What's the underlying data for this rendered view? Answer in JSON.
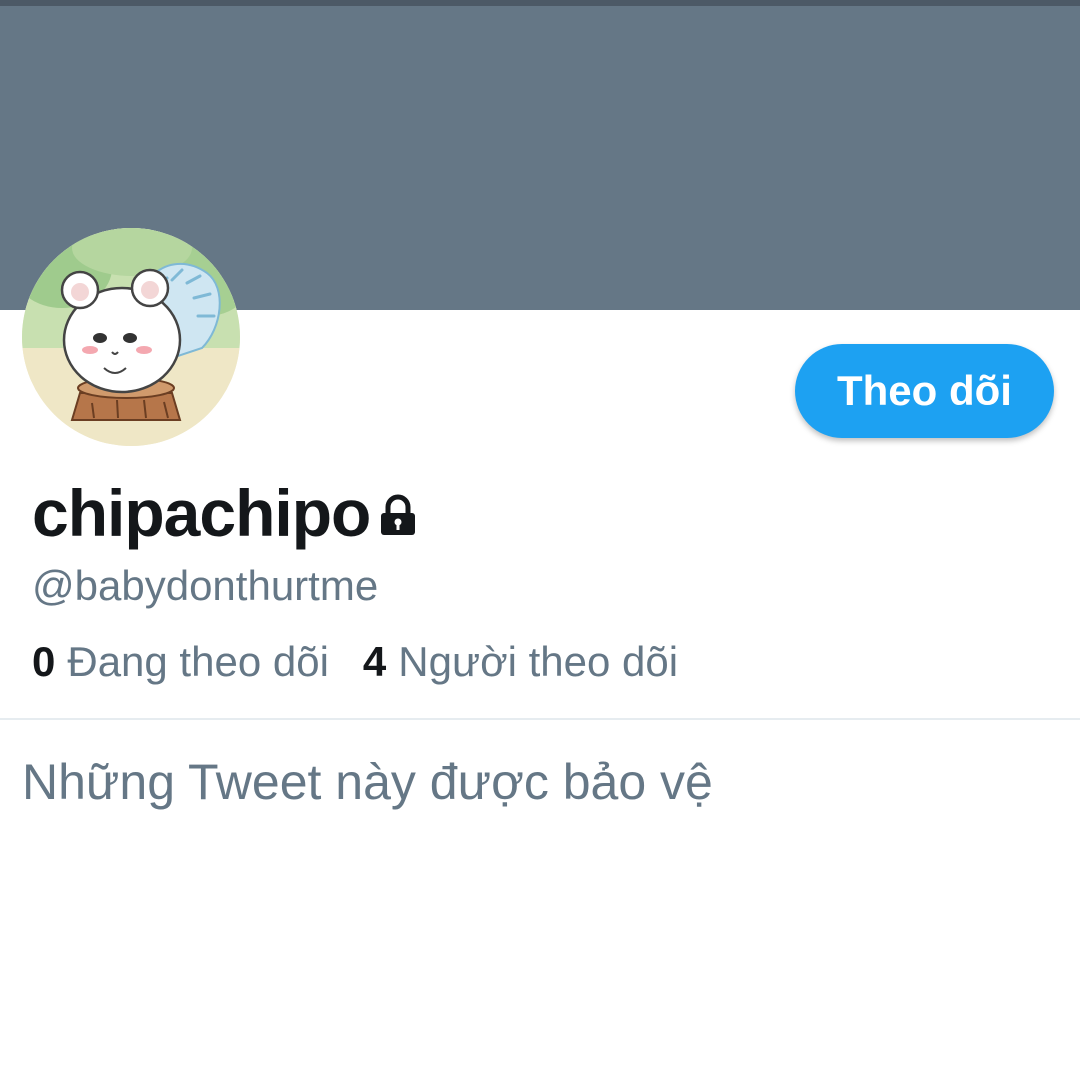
{
  "profile": {
    "display_name": "chipachipo",
    "handle": "@babydonthurtme",
    "protected": true,
    "avatar_icon": "chinchilla-on-stump-avatar"
  },
  "actions": {
    "follow_label": "Theo dõi"
  },
  "stats": {
    "following_count": "0",
    "following_label": "Đang theo dõi",
    "followers_count": "4",
    "followers_label": "Người theo dõi"
  },
  "timeline": {
    "protected_message": "Những Tweet này được bảo vệ"
  },
  "colors": {
    "banner": "#657786",
    "accent": "#1da1f2",
    "text_primary": "#14171a",
    "text_secondary": "#657786"
  }
}
